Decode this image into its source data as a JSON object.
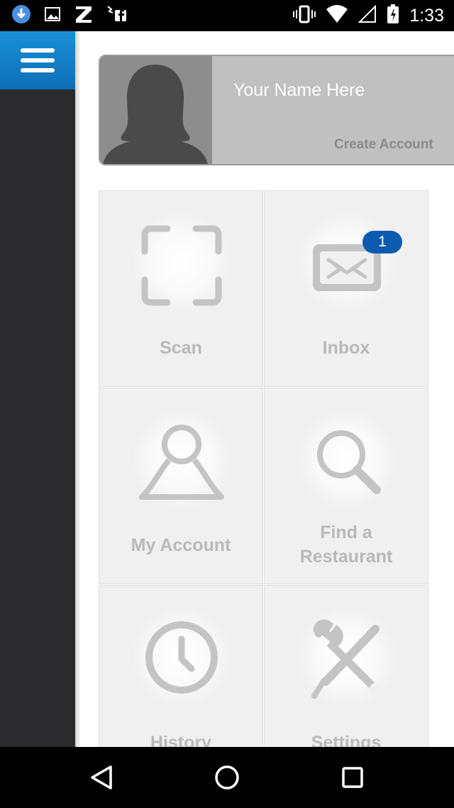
{
  "status_bar": {
    "time": "1:33",
    "left_icons": [
      "download-icon",
      "image-icon",
      "z-app-icon",
      "facebook-icon"
    ],
    "right_icons": [
      "vibrate-icon",
      "wifi-icon",
      "signal-icon",
      "battery-icon"
    ]
  },
  "drawer": {
    "menu_icon": "hamburger-icon",
    "accent": "#1a90d8"
  },
  "profile": {
    "name": "Your Name Here",
    "create_account": "Create Account"
  },
  "tiles": [
    {
      "label": "Scan",
      "icon": "scan-icon"
    },
    {
      "label": "Inbox",
      "icon": "mail-icon",
      "badge": "1"
    },
    {
      "label": "My Account",
      "icon": "person-icon"
    },
    {
      "label_line1": "Find a",
      "label_line2": "Restaurant",
      "icon": "search-icon"
    },
    {
      "label": "History",
      "icon": "clock-icon"
    },
    {
      "label": "Settings",
      "icon": "tools-icon"
    }
  ],
  "nav_bar": {
    "icons": [
      "back-icon",
      "home-icon",
      "recents-icon"
    ]
  }
}
